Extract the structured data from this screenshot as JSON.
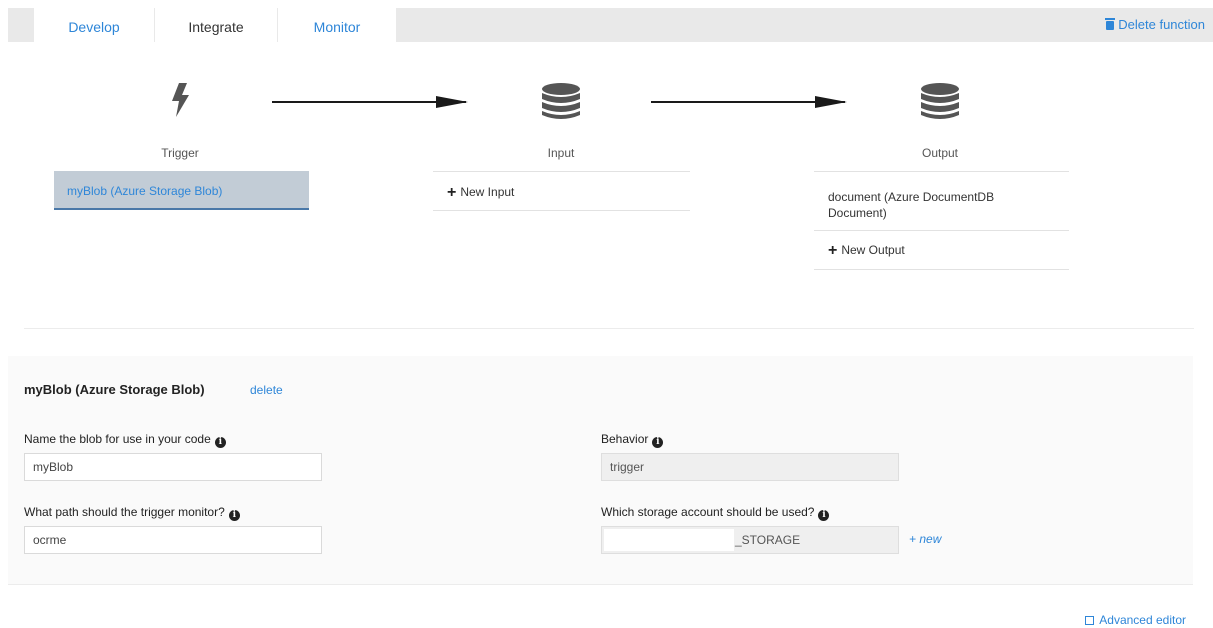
{
  "tabs": [
    {
      "label": "Develop",
      "active": false
    },
    {
      "label": "Integrate",
      "active": true
    },
    {
      "label": "Monitor",
      "active": false
    }
  ],
  "header": {
    "delete_function_label": "Delete function",
    "delete_icon": "trash-icon"
  },
  "flow": {
    "trigger": {
      "label": "Trigger",
      "icon": "lightning-bolt-icon",
      "selected_item": "myBlob (Azure Storage Blob)"
    },
    "input": {
      "label": "Input",
      "icon": "database-icon",
      "new_label": "New Input"
    },
    "output": {
      "label": "Output",
      "icon": "database-icon",
      "items": [
        "document (Azure DocumentDB Document)"
      ],
      "new_label": "New Output"
    }
  },
  "details": {
    "title": "myBlob (Azure Storage Blob)",
    "delete_label": "delete",
    "name_label": "Name the blob for use in your code",
    "name_value": "myBlob",
    "path_label": "What path should the trigger monitor?",
    "path_value": "ocrme",
    "behavior_label": "Behavior",
    "behavior_value": "trigger",
    "storage_label": "Which storage account should be used?",
    "storage_value": "_STORAGE",
    "new_label": "+ new",
    "info_glyph": "i"
  },
  "footer": {
    "advanced_editor_label": "Advanced editor"
  },
  "colors": {
    "link": "#2e86d8",
    "selected_bg": "#c2ccd6",
    "tabbar_bg": "#e9e9e9"
  }
}
